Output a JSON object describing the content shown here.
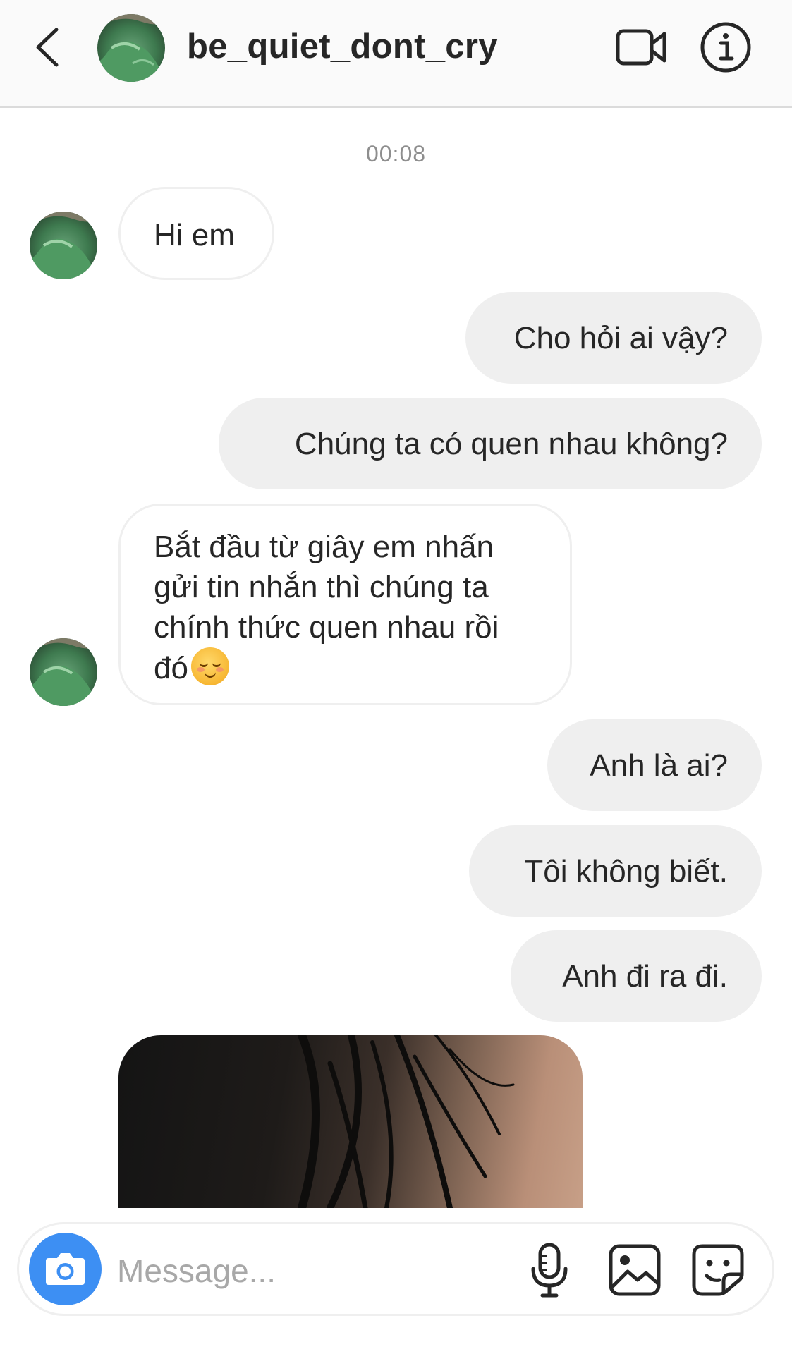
{
  "header": {
    "username": "be_quiet_dont_cry",
    "back_icon": "chevron-left-icon",
    "video_icon": "video-camera-icon",
    "info_icon": "info-icon"
  },
  "thread": {
    "timestamp": "00:08",
    "messages": [
      {
        "direction": "incoming",
        "text": "Hi em"
      },
      {
        "direction": "outgoing",
        "text": "Cho hỏi ai vậy?"
      },
      {
        "direction": "outgoing",
        "text": "Chúng ta có quen nhau không?"
      },
      {
        "direction": "incoming",
        "lines": [
          "Bắt đầu từ giây em nhấn",
          "gửi tin nhắn thì chúng ta",
          "chính thức quen nhau rồi",
          "đó"
        ],
        "emoji": "smiling-face-emoji"
      },
      {
        "direction": "outgoing",
        "text": "Anh là ai?"
      },
      {
        "direction": "outgoing",
        "text": "Tôi không biết."
      },
      {
        "direction": "outgoing",
        "text": "Anh đi ra đi."
      },
      {
        "direction": "incoming",
        "type": "photo"
      }
    ]
  },
  "composer": {
    "placeholder": "Message...",
    "camera_icon": "camera-icon",
    "mic_icon": "microphone-icon",
    "gallery_icon": "image-icon",
    "sticker_icon": "sticker-icon"
  },
  "colors": {
    "header_bg": "#fafafa",
    "outgoing_bubble": "#efefef",
    "incoming_border": "#efefef",
    "camera_button": "#3d8ff3",
    "timestamp": "#8e8e8e",
    "placeholder": "#a8a8a8"
  }
}
